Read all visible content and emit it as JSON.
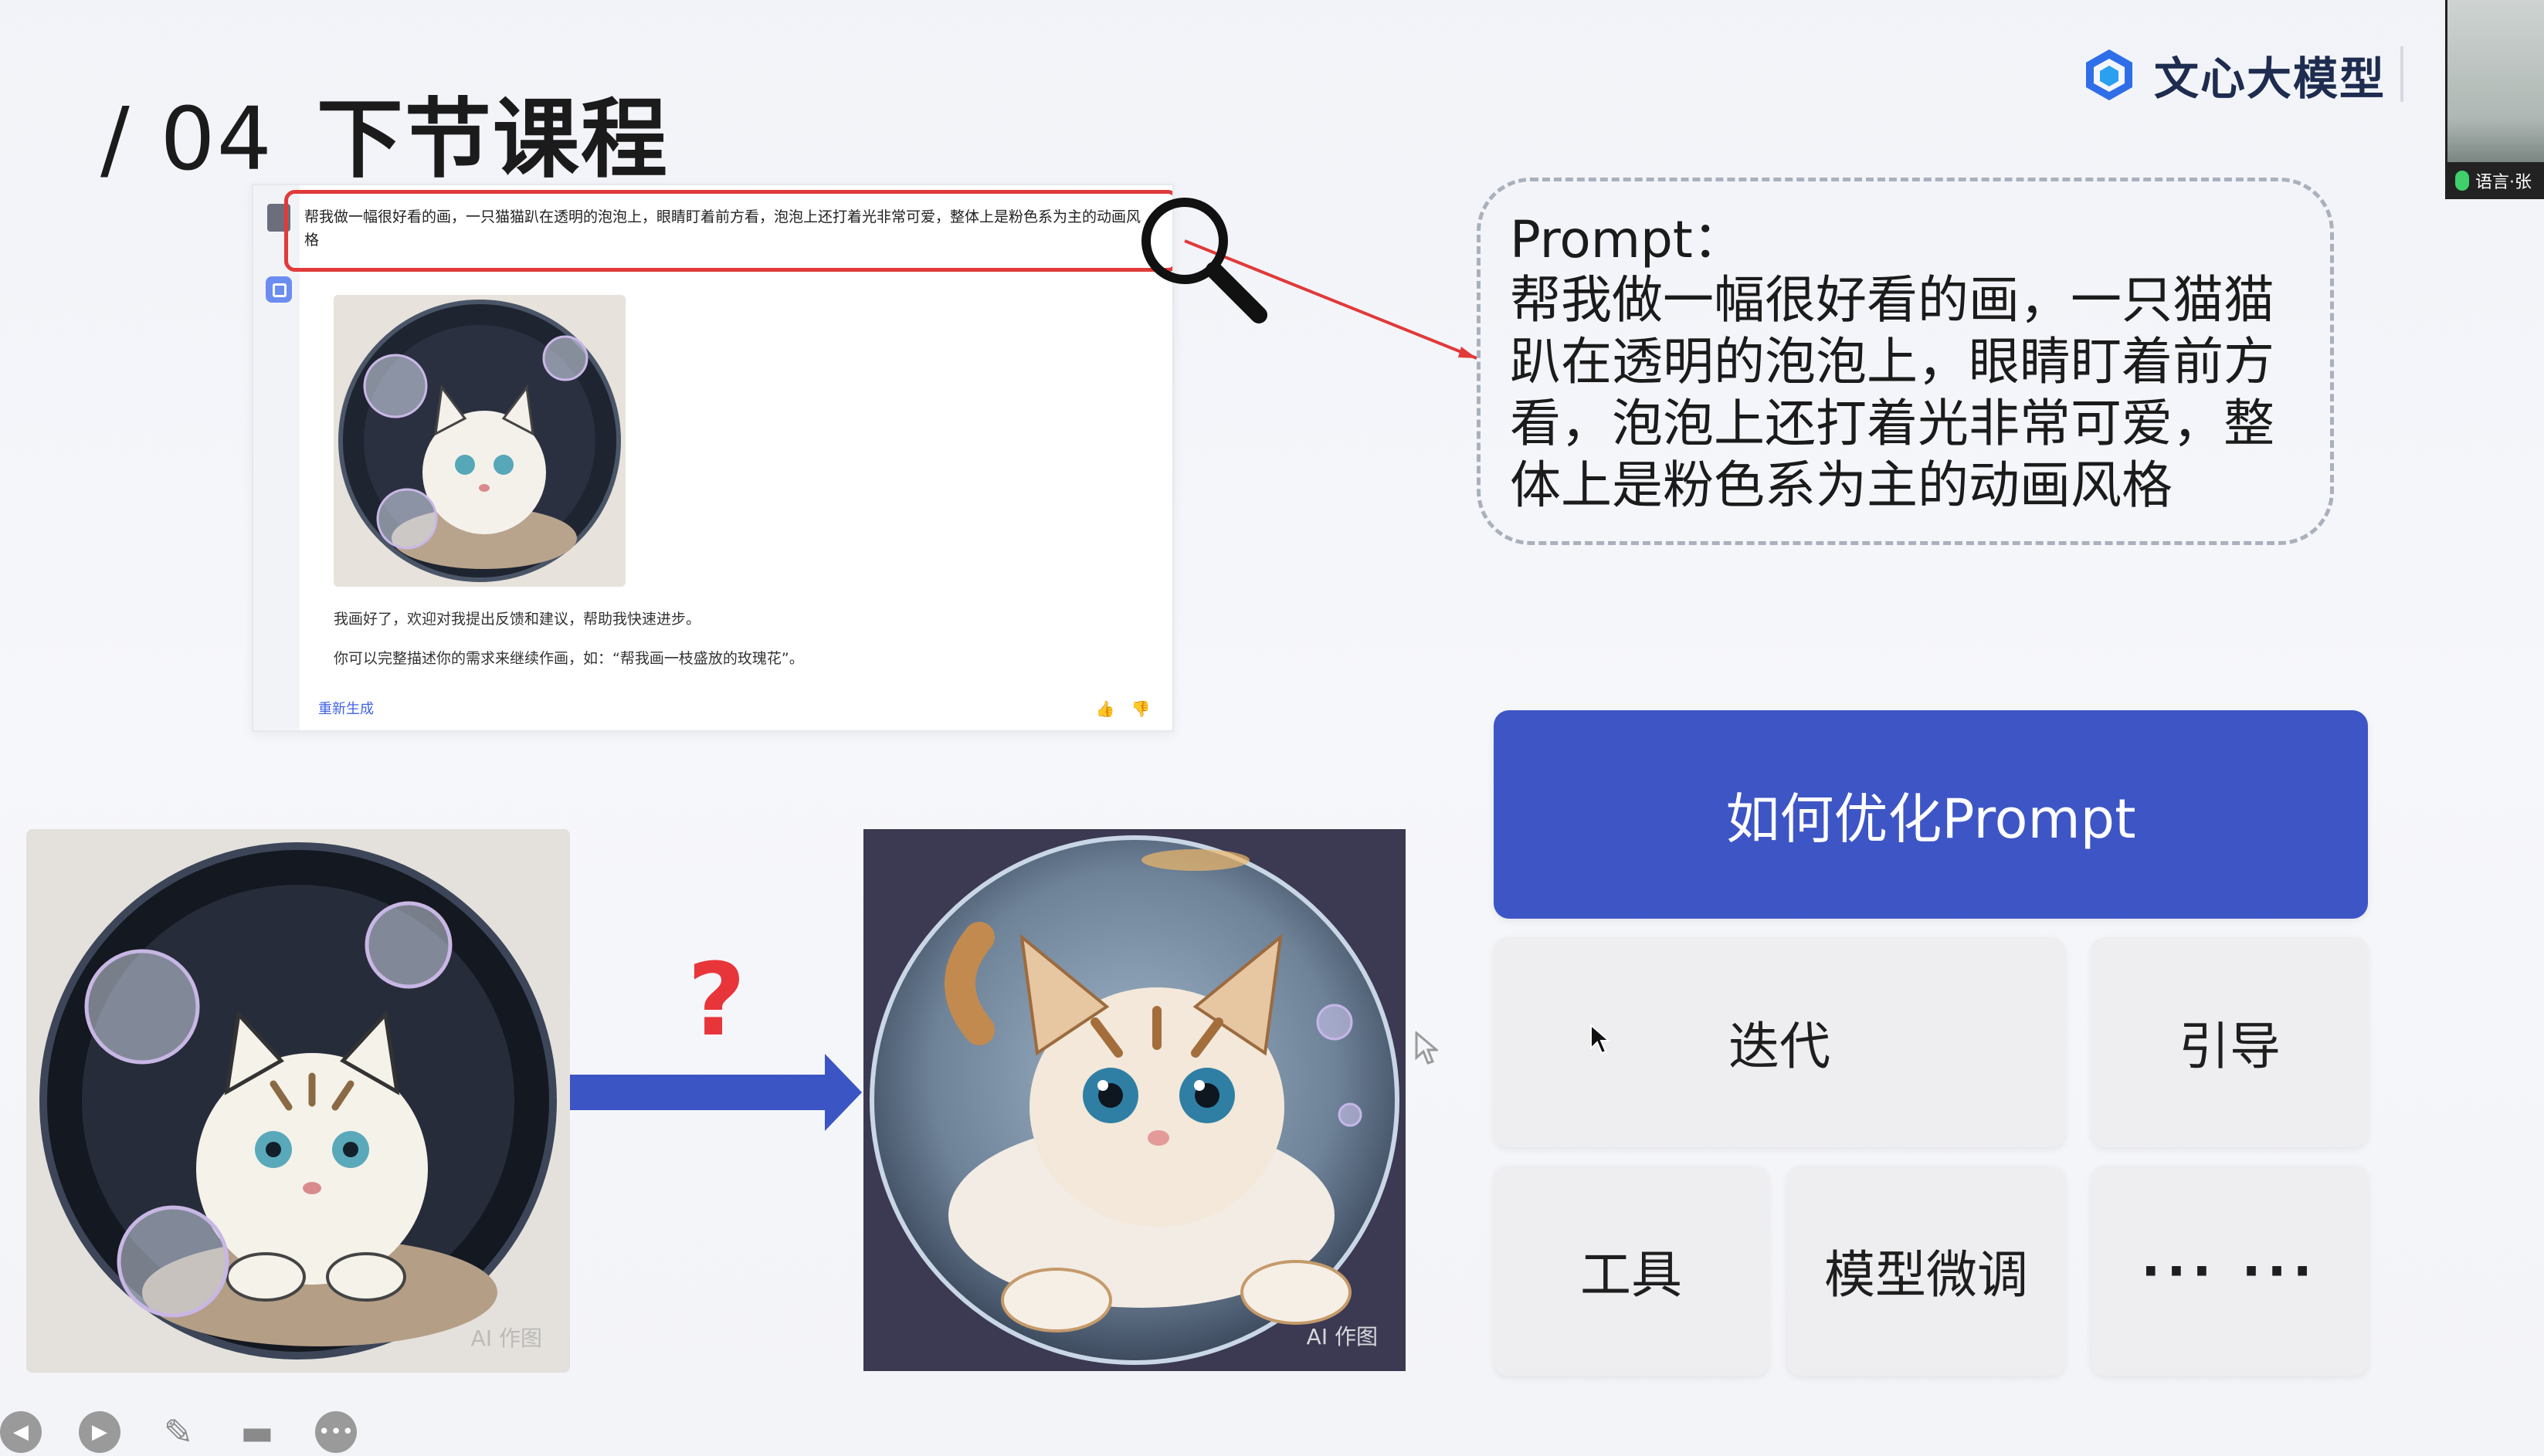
{
  "slide": {
    "number": "/ 04",
    "title": "下节课程"
  },
  "brand": {
    "name": "文心大模型",
    "logo_icon": "wenxin-logo-icon"
  },
  "webcam": {
    "name_label": "语言·张"
  },
  "chat_example": {
    "prompt_text": "帮我做一幅很好看的画，一只猫猫趴在透明的泡泡上，眼睛盯着前方看，泡泡上还打着光非常可爱，整体上是粉色系为主的动画风格",
    "reply_line1": "我画好了，欢迎对我提出反馈和建议，帮助我快速进步。",
    "reply_line2": "你可以完整描述你的需求来继续作画，如：“帮我画一枝盛放的玫瑰花”。",
    "regenerate_label": "重新生成",
    "thumb_up_icon": "thumb-up-icon",
    "thumb_down_icon": "thumb-down-icon",
    "highlight_color": "#e13a3a"
  },
  "callout": {
    "label": "Prompt：",
    "text": "帮我做一幅很好看的画，一只猫猫趴在透明的泡泡上，眼睛盯着前方看，泡泡上还打着光非常可爱，整体上是粉色系为主的动画风格"
  },
  "comparison": {
    "question_mark": "?",
    "right_tag": "AI 作图",
    "left_tag": "AI 作图",
    "arrow_color": "#3b55c4"
  },
  "topics": {
    "main": "如何优化Prompt",
    "items": [
      "迭代",
      "引导",
      "工具",
      "模型微调",
      "··· ···"
    ],
    "accent": "#3e55c5"
  },
  "toolbar": {
    "buttons": [
      "prev-icon",
      "next-icon",
      "pen-icon",
      "camera-icon",
      "more-icon"
    ]
  }
}
